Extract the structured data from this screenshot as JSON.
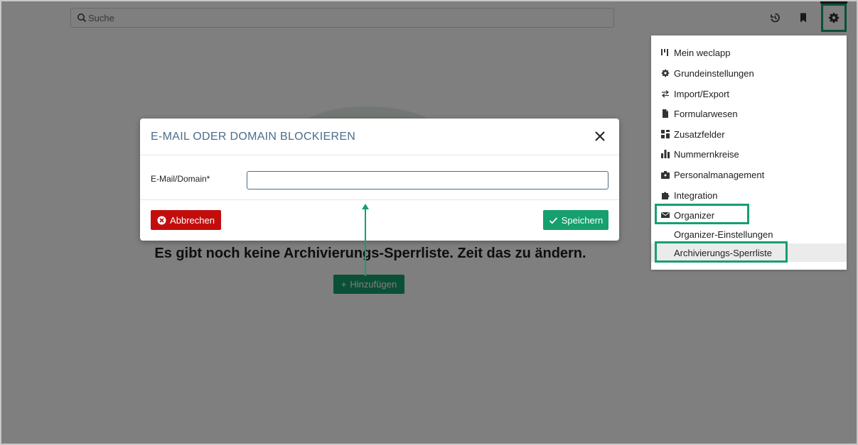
{
  "search": {
    "placeholder": "Suche"
  },
  "page": {
    "empty_message": "Es gibt noch keine Archivierungs-Sperrliste. Zeit das zu ändern.",
    "add_button": "Hinzufügen"
  },
  "modal": {
    "title": "E-MAIL ODER DOMAIN BLOCKIEREN",
    "field_label": "E-Mail/Domain*",
    "field_value": "",
    "cancel_label": "Abbrechen",
    "save_label": "Speichern"
  },
  "menu": {
    "items": [
      {
        "label": "Mein weclapp",
        "icon": "dashboard-icon"
      },
      {
        "label": "Grundeinstellungen",
        "icon": "gear-icon"
      },
      {
        "label": "Import/Export",
        "icon": "arrows-icon"
      },
      {
        "label": "Formularwesen",
        "icon": "document-icon"
      },
      {
        "label": "Zusatzfelder",
        "icon": "grid-icon"
      },
      {
        "label": "Nummernkreise",
        "icon": "bar-chart-icon"
      },
      {
        "label": "Personalmanagement",
        "icon": "id-badge-icon"
      },
      {
        "label": "Integration",
        "icon": "puzzle-icon"
      },
      {
        "label": "Organizer",
        "icon": "envelope-icon"
      }
    ],
    "sub_items": [
      {
        "label": "Organizer-Einstellungen"
      },
      {
        "label": "Archivierungs-Sperrliste"
      }
    ]
  },
  "colors": {
    "accent": "#15a06e",
    "danger": "#c30d0d",
    "title": "#4a6d8c"
  }
}
